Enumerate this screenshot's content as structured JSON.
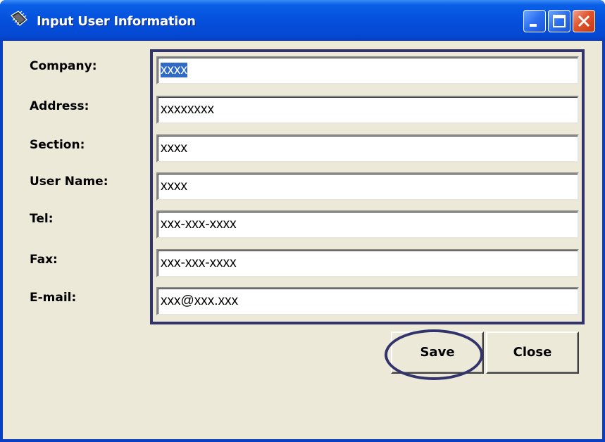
{
  "window": {
    "title": "Input User Information",
    "icon": "app-chip-icon"
  },
  "titlebar_buttons": {
    "minimize_icon": "minimize-icon",
    "maximize_icon": "maximize-icon",
    "close_icon": "close-icon"
  },
  "form": {
    "fields": [
      {
        "label": "Company:",
        "value": "xxxx"
      },
      {
        "label": "Address:",
        "value": "xxxxxxxx"
      },
      {
        "label": "Section:",
        "value": "xxxx"
      },
      {
        "label": "User Name:",
        "value": "xxxx"
      },
      {
        "label": "Tel:",
        "value": "xxx-xxx-xxxx"
      },
      {
        "label": "Fax:",
        "value": "xxx-xxx-xxxx"
      },
      {
        "label": "E-mail:",
        "value": "xxx@xxx.xxx"
      }
    ]
  },
  "buttons": {
    "save_label": "Save",
    "close_label": "Close"
  },
  "colors": {
    "titlebar": "#0550dc",
    "client_background": "#ece9d8",
    "selection": "#316ac5",
    "annotation_outline": "#33336b"
  }
}
